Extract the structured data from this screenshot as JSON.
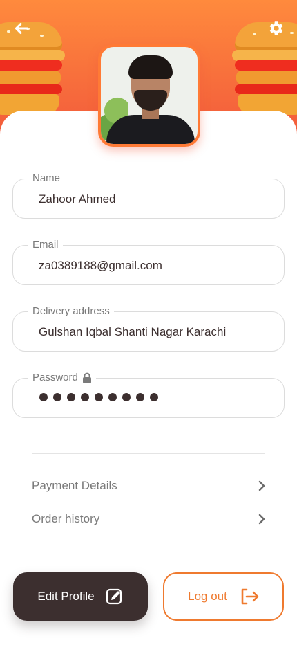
{
  "profile": {
    "name_label": "Name",
    "name_value": "Zahoor Ahmed",
    "email_label": "Email",
    "email_value": "za0389188@gmail.com",
    "address_label": "Delivery address",
    "address_value": "Gulshan Iqbal Shanti Nagar Karachi",
    "password_label": "Password",
    "password_dot_count": 9
  },
  "menu": {
    "items": [
      {
        "label": "Payment Details",
        "icon": "chevron-right-icon"
      },
      {
        "label": "Order history",
        "icon": "chevron-right-icon"
      }
    ]
  },
  "actions": {
    "edit_label": "Edit Profile",
    "logout_label": "Log out"
  },
  "colors": {
    "accent": "#ef7a2f",
    "header_top": "#ff8a3d",
    "header_bottom": "#f25a3b",
    "dark": "#3c2f2f",
    "muted": "#7a7a7a"
  },
  "icons": {
    "header_left": "back-arrow-icon",
    "header_right": "gear-icon",
    "edit": "edit-note-icon",
    "logout": "logout-icon",
    "password": "lock-icon"
  }
}
